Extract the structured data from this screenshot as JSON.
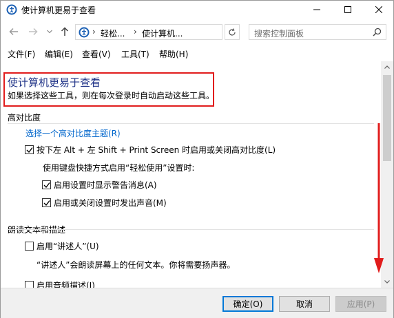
{
  "window": {
    "title": "使计算机更易于查看"
  },
  "nav": {
    "address_segments": [
      "轻松...",
      "使计算机..."
    ],
    "search_placeholder": "搜索控制面板"
  },
  "menu": [
    "文件(F)",
    "编辑(E)",
    "查看(V)",
    "工具(T)",
    "帮助(H)"
  ],
  "page": {
    "heading": "使计算机更易于查看",
    "subtitle": "如果选择这些工具，则在每次登录时自动启动这些工具。"
  },
  "sections": {
    "high_contrast": {
      "title": "高对比度",
      "link": "选择一个高对比度主题(R)",
      "toggle_label": "按下左 Alt + 左 Shift + Print Screen 时启用或关闭高对比度(L)",
      "toggle_checked": true,
      "shortcut_intro": "使用键盘快捷方式启用“轻松使用”设置时:",
      "warn_label": "启用设置时显示警告消息(A)",
      "warn_checked": true,
      "sound_label": "启用或关闭设置时发出声音(M)",
      "sound_checked": true
    },
    "narrator": {
      "title": "朗读文本和描述",
      "narrator_label": "启用“讲述人”(U)",
      "narrator_checked": false,
      "narrator_desc": "“讲述人”会朗读屏幕上的任何文本。你将需要扬声器。",
      "audio_desc_label": "启用音频描述(I)",
      "audio_desc_checked": false
    }
  },
  "buttons": {
    "ok": "确定(O)",
    "cancel": "取消",
    "apply": "应用(P)"
  },
  "colors": {
    "highlight_box": "#e11c1c",
    "heading": "#1e3287",
    "link": "#0066cc",
    "annotation_arrow": "#e11c1c"
  }
}
